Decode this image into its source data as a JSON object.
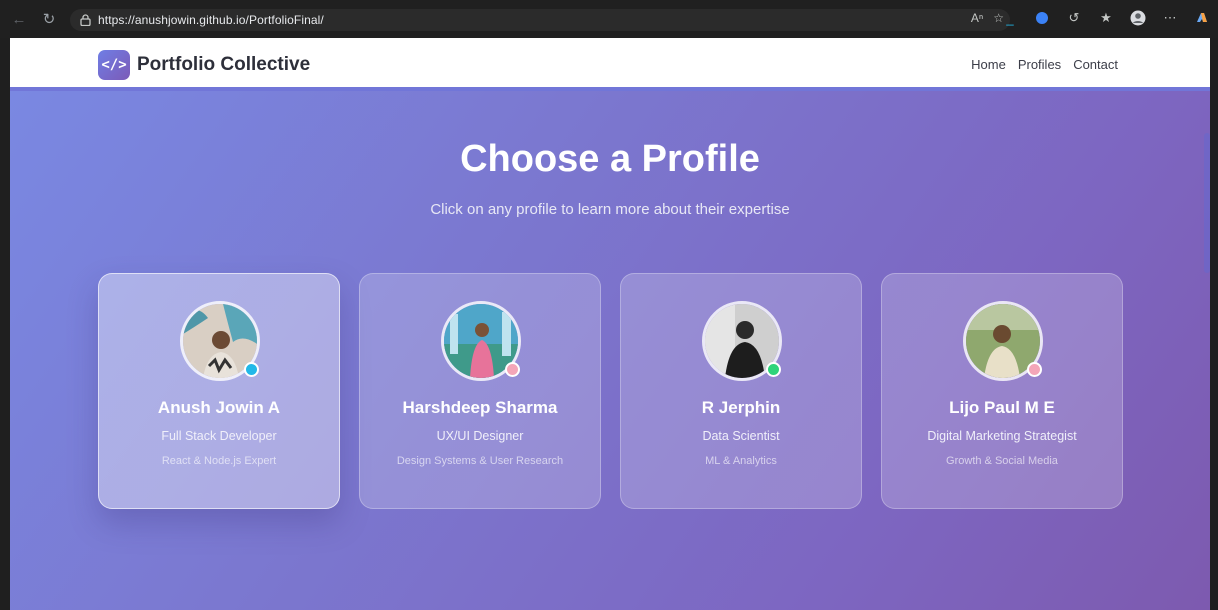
{
  "browser": {
    "url": "https://anushjowin.github.io/PortfolioFinal/",
    "back_icon": "arrow-left-icon",
    "reload_icon": "reload-icon"
  },
  "navbar": {
    "logo_glyph": "</>",
    "brand": "Portfolio Collective",
    "links": [
      "Home",
      "Profiles",
      "Contact"
    ]
  },
  "hero": {
    "title": "Choose a Profile",
    "subtitle": "Click on any profile to learn more about their expertise"
  },
  "profiles": [
    {
      "name": "Anush Jowin A",
      "role": "Full Stack Developer",
      "specialty": "React & Node.js Expert",
      "status_color": "#22b8e8",
      "active": true
    },
    {
      "name": "Harshdeep Sharma",
      "role": "UX/UI Designer",
      "specialty": "Design Systems & User Research",
      "status_color": "#f4a6b8",
      "active": false
    },
    {
      "name": "R Jerphin",
      "role": "Data Scientist",
      "specialty": "ML & Analytics",
      "status_color": "#2ed47a",
      "active": false
    },
    {
      "name": "Lijo Paul M E",
      "role": "Digital Marketing Strategist",
      "specialty": "Growth & Social Media",
      "status_color": "#f4a6b8",
      "active": false
    }
  ],
  "colors": {
    "gradient_start": "#7a89e3",
    "gradient_end": "#7d5aaf",
    "brand_text": "#2d2f3a"
  }
}
